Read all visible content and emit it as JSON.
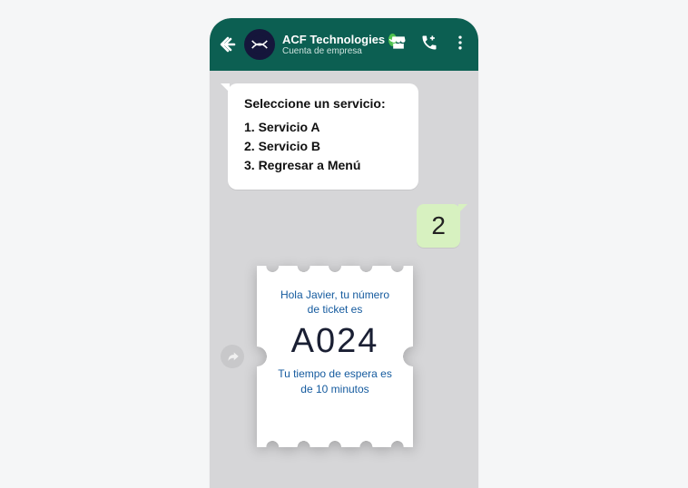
{
  "header": {
    "business_name": "ACF Technologies",
    "account_type": "Cuenta de empresa"
  },
  "messages": {
    "service_prompt": "Seleccione un servicio:",
    "options": {
      "opt1": "1. Servicio A",
      "opt2": "2. Servicio B",
      "opt3": "3. Regresar a Menú"
    },
    "user_reply": "2"
  },
  "ticket": {
    "greeting": "Hola Javier, tu número de ticket es",
    "number": "A024",
    "wait": "Tu tiempo de espera es de 10 minutos"
  }
}
